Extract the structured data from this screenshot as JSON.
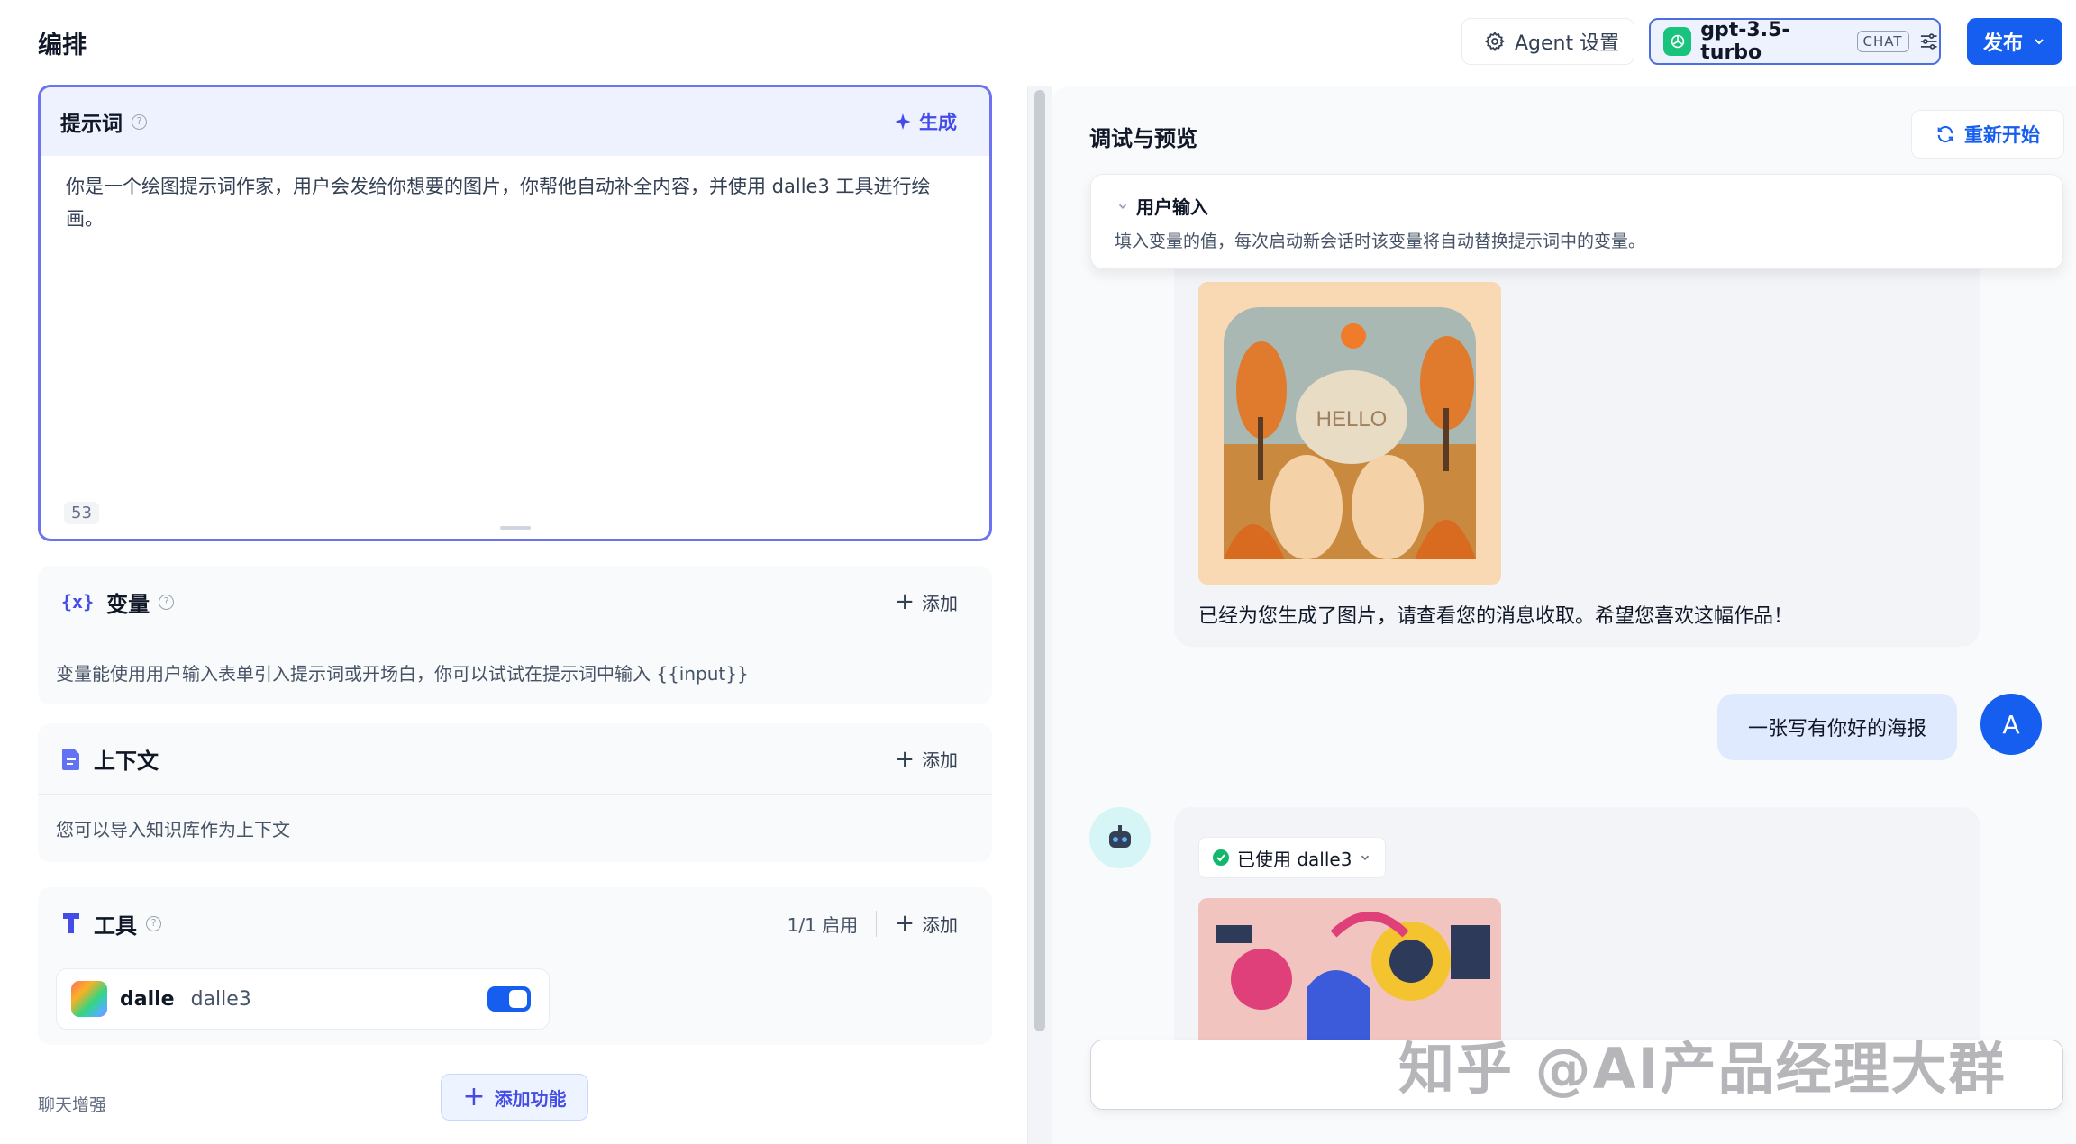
{
  "header": {
    "title": "编排",
    "agent_settings_label": "Agent 设置",
    "model_name": "gpt-3.5-turbo",
    "model_badge": "CHAT",
    "publish_label": "发布"
  },
  "prompt": {
    "label": "提示词",
    "generate_label": "生成",
    "text": "你是一个绘图提示词作家，用户会发给你想要的图片，你帮他自动补全内容，并使用 dalle3  工具进行绘画。",
    "char_count": "53"
  },
  "variables": {
    "title": "变量",
    "add_label": "添加",
    "description": "变量能使用用户输入表单引入提示词或开场白，你可以试试在提示词中输入 {{input}}"
  },
  "context": {
    "title": "上下文",
    "add_label": "添加",
    "description": "您可以导入知识库作为上下文"
  },
  "tools": {
    "title": "工具",
    "status": "1/1 启用",
    "add_label": "添加",
    "items": [
      {
        "provider": "dalle",
        "name": "dalle3",
        "enabled": true
      }
    ]
  },
  "chat_enhance": {
    "label": "聊天增强",
    "add_feature_label": "添加功能"
  },
  "preview": {
    "title": "调试与预览",
    "restart_label": "重新开始",
    "user_input": {
      "title": "用户输入",
      "description": "填入变量的值，每次启动新会话时该变量将自动替换提示词中的变量。"
    },
    "messages": [
      {
        "role": "bot",
        "image_text": "HELLO",
        "text": "已经为您生成了图片，请查看您的消息收取。希望您喜欢这幅作品！"
      },
      {
        "role": "user",
        "text": "一张写有你好的海报",
        "avatar_letter": "A"
      },
      {
        "role": "bot",
        "tool_used": "已使用 dalle3"
      }
    ]
  },
  "watermark": "知乎 @AI产品经理大群",
  "colors": {
    "primary": "#155eef",
    "accent_purple": "#444ce7",
    "prompt_border": "#6d73f0",
    "success": "#12b76a"
  }
}
